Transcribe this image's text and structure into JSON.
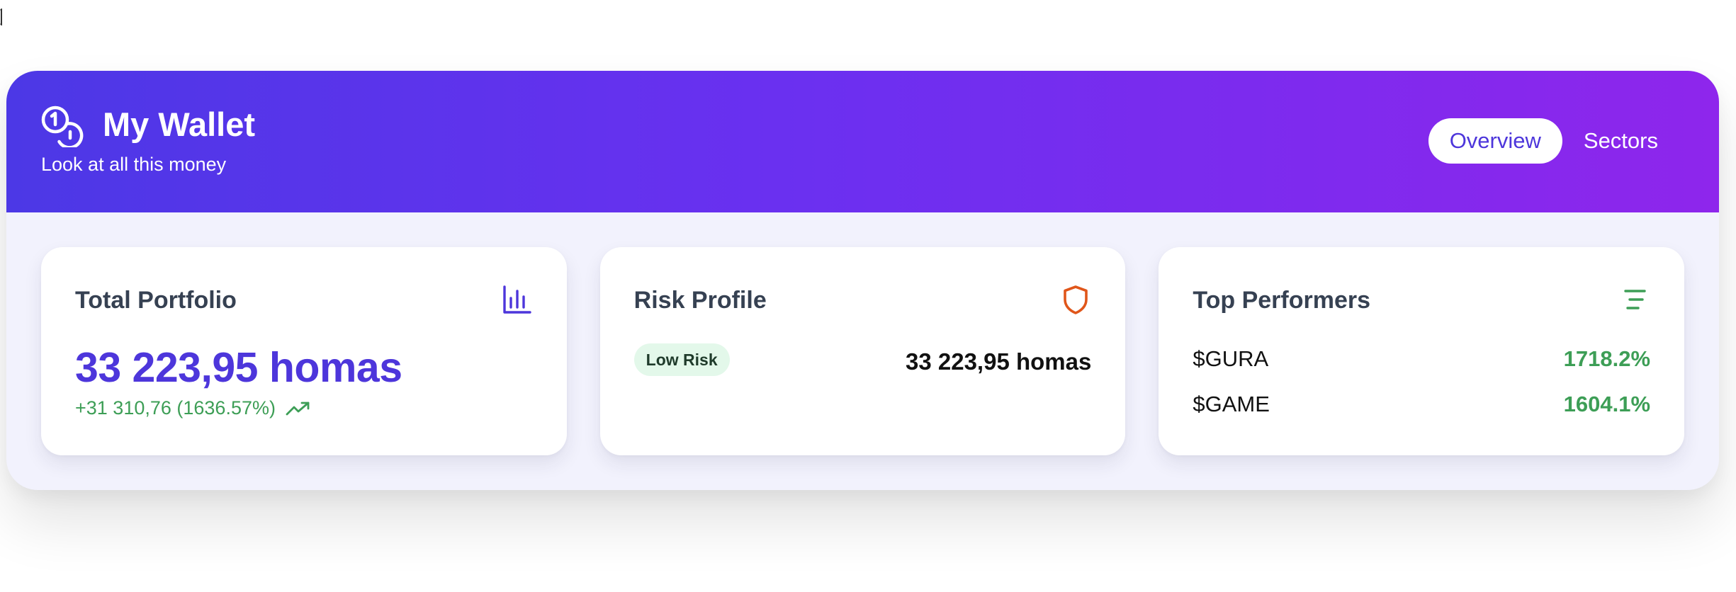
{
  "header": {
    "title": "My Wallet",
    "subtitle": "Look at all this money",
    "tabs": [
      {
        "label": "Overview",
        "active": true
      },
      {
        "label": "Sectors",
        "active": false
      }
    ],
    "icon": "coins-icon"
  },
  "colors": {
    "gradient_start": "#4c38e6",
    "gradient_end": "#8e26ec",
    "accent": "#4d36db",
    "positive": "#3d9e56",
    "risk_icon": "#e0561a",
    "badge_bg": "#e3f8ea"
  },
  "cards": {
    "portfolio": {
      "title": "Total Portfolio",
      "value": "33 223,95 homas",
      "change": "+31 310,76 (1636.57%)",
      "icon": "bar-chart-icon",
      "trend_icon": "trending-up-icon"
    },
    "risk": {
      "title": "Risk Profile",
      "badge": "Low Risk",
      "value": "33 223,95 homas",
      "icon": "shield-icon"
    },
    "performers": {
      "title": "Top Performers",
      "icon": "list-icon",
      "items": [
        {
          "symbol": "$GURA",
          "value": "1718.2%"
        },
        {
          "symbol": "$GAME",
          "value": "1604.1%"
        }
      ]
    }
  }
}
